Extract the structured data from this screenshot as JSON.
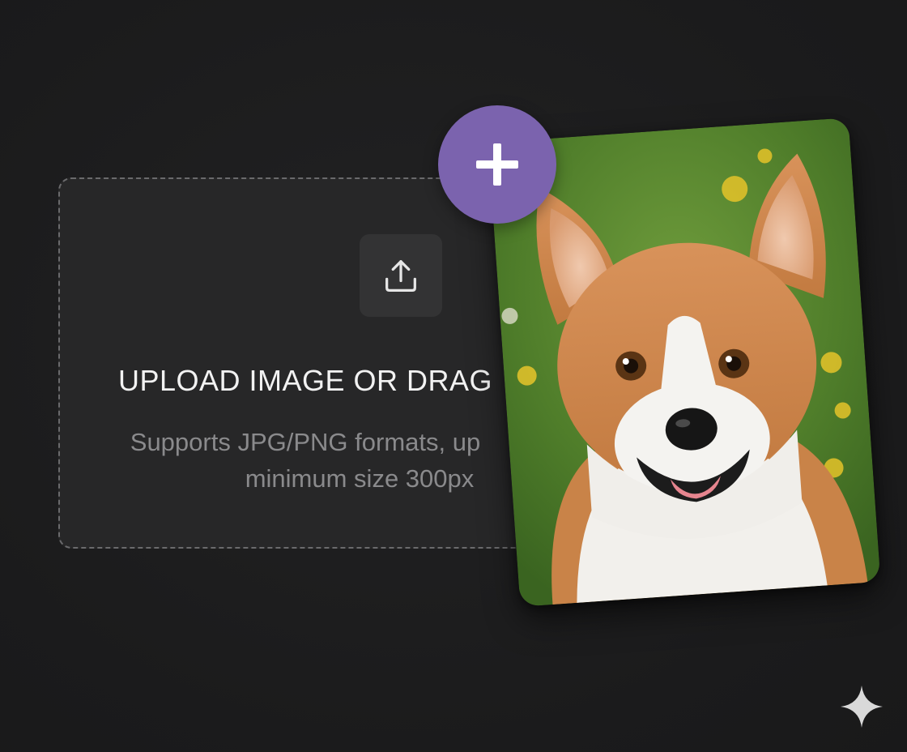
{
  "upload": {
    "title": "UPLOAD IMAGE OR DRAG",
    "hint_line1": "Supports JPG/PNG formats, up",
    "hint_line2": "minimum size 300px",
    "icon": "upload-icon"
  },
  "photo": {
    "subject": "corgi-photo"
  },
  "add_button": {
    "icon": "plus-icon",
    "color": "#7b63ae"
  },
  "corner_mark": {
    "icon": "sparkle-icon",
    "color": "#d9d9d9"
  },
  "colors": {
    "background": "#1c1c1d",
    "dropzone": "#272728",
    "dropzone_border": "#6a6a6c",
    "accent": "#7b63ae"
  }
}
